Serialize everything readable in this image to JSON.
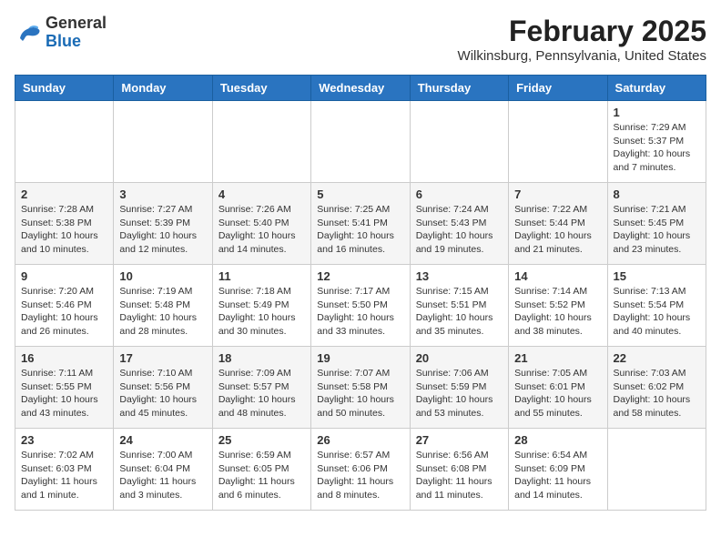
{
  "logo": {
    "general": "General",
    "blue": "Blue"
  },
  "title": "February 2025",
  "subtitle": "Wilkinsburg, Pennsylvania, United States",
  "days_of_week": [
    "Sunday",
    "Monday",
    "Tuesday",
    "Wednesday",
    "Thursday",
    "Friday",
    "Saturday"
  ],
  "weeks": [
    [
      {
        "day": "",
        "info": ""
      },
      {
        "day": "",
        "info": ""
      },
      {
        "day": "",
        "info": ""
      },
      {
        "day": "",
        "info": ""
      },
      {
        "day": "",
        "info": ""
      },
      {
        "day": "",
        "info": ""
      },
      {
        "day": "1",
        "info": "Sunrise: 7:29 AM\nSunset: 5:37 PM\nDaylight: 10 hours and 7 minutes."
      }
    ],
    [
      {
        "day": "2",
        "info": "Sunrise: 7:28 AM\nSunset: 5:38 PM\nDaylight: 10 hours and 10 minutes."
      },
      {
        "day": "3",
        "info": "Sunrise: 7:27 AM\nSunset: 5:39 PM\nDaylight: 10 hours and 12 minutes."
      },
      {
        "day": "4",
        "info": "Sunrise: 7:26 AM\nSunset: 5:40 PM\nDaylight: 10 hours and 14 minutes."
      },
      {
        "day": "5",
        "info": "Sunrise: 7:25 AM\nSunset: 5:41 PM\nDaylight: 10 hours and 16 minutes."
      },
      {
        "day": "6",
        "info": "Sunrise: 7:24 AM\nSunset: 5:43 PM\nDaylight: 10 hours and 19 minutes."
      },
      {
        "day": "7",
        "info": "Sunrise: 7:22 AM\nSunset: 5:44 PM\nDaylight: 10 hours and 21 minutes."
      },
      {
        "day": "8",
        "info": "Sunrise: 7:21 AM\nSunset: 5:45 PM\nDaylight: 10 hours and 23 minutes."
      }
    ],
    [
      {
        "day": "9",
        "info": "Sunrise: 7:20 AM\nSunset: 5:46 PM\nDaylight: 10 hours and 26 minutes."
      },
      {
        "day": "10",
        "info": "Sunrise: 7:19 AM\nSunset: 5:48 PM\nDaylight: 10 hours and 28 minutes."
      },
      {
        "day": "11",
        "info": "Sunrise: 7:18 AM\nSunset: 5:49 PM\nDaylight: 10 hours and 30 minutes."
      },
      {
        "day": "12",
        "info": "Sunrise: 7:17 AM\nSunset: 5:50 PM\nDaylight: 10 hours and 33 minutes."
      },
      {
        "day": "13",
        "info": "Sunrise: 7:15 AM\nSunset: 5:51 PM\nDaylight: 10 hours and 35 minutes."
      },
      {
        "day": "14",
        "info": "Sunrise: 7:14 AM\nSunset: 5:52 PM\nDaylight: 10 hours and 38 minutes."
      },
      {
        "day": "15",
        "info": "Sunrise: 7:13 AM\nSunset: 5:54 PM\nDaylight: 10 hours and 40 minutes."
      }
    ],
    [
      {
        "day": "16",
        "info": "Sunrise: 7:11 AM\nSunset: 5:55 PM\nDaylight: 10 hours and 43 minutes."
      },
      {
        "day": "17",
        "info": "Sunrise: 7:10 AM\nSunset: 5:56 PM\nDaylight: 10 hours and 45 minutes."
      },
      {
        "day": "18",
        "info": "Sunrise: 7:09 AM\nSunset: 5:57 PM\nDaylight: 10 hours and 48 minutes."
      },
      {
        "day": "19",
        "info": "Sunrise: 7:07 AM\nSunset: 5:58 PM\nDaylight: 10 hours and 50 minutes."
      },
      {
        "day": "20",
        "info": "Sunrise: 7:06 AM\nSunset: 5:59 PM\nDaylight: 10 hours and 53 minutes."
      },
      {
        "day": "21",
        "info": "Sunrise: 7:05 AM\nSunset: 6:01 PM\nDaylight: 10 hours and 55 minutes."
      },
      {
        "day": "22",
        "info": "Sunrise: 7:03 AM\nSunset: 6:02 PM\nDaylight: 10 hours and 58 minutes."
      }
    ],
    [
      {
        "day": "23",
        "info": "Sunrise: 7:02 AM\nSunset: 6:03 PM\nDaylight: 11 hours and 1 minute."
      },
      {
        "day": "24",
        "info": "Sunrise: 7:00 AM\nSunset: 6:04 PM\nDaylight: 11 hours and 3 minutes."
      },
      {
        "day": "25",
        "info": "Sunrise: 6:59 AM\nSunset: 6:05 PM\nDaylight: 11 hours and 6 minutes."
      },
      {
        "day": "26",
        "info": "Sunrise: 6:57 AM\nSunset: 6:06 PM\nDaylight: 11 hours and 8 minutes."
      },
      {
        "day": "27",
        "info": "Sunrise: 6:56 AM\nSunset: 6:08 PM\nDaylight: 11 hours and 11 minutes."
      },
      {
        "day": "28",
        "info": "Sunrise: 6:54 AM\nSunset: 6:09 PM\nDaylight: 11 hours and 14 minutes."
      },
      {
        "day": "",
        "info": ""
      }
    ]
  ]
}
